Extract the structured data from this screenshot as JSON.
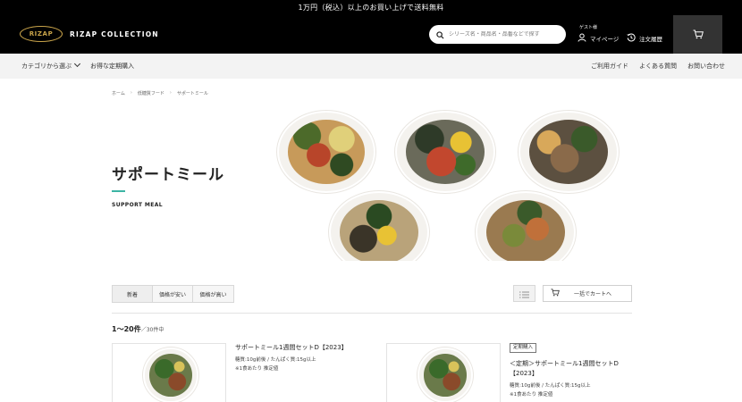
{
  "promo_banner": "1万円（税込）以上のお買い上げで送料無料",
  "header": {
    "logo_mark": "RIZAP",
    "logo_text": "RIZAP COLLECTION",
    "search_placeholder": "シリーズ名・商品名・品番などで探す",
    "guest_label": "ゲスト様",
    "mypage_label": "マイページ",
    "history_label": "注文履歴",
    "icons": {
      "search": "search-icon",
      "user": "user-icon",
      "history": "history-icon",
      "cart": "cart-icon"
    }
  },
  "nav": {
    "category_label": "カテゴリから選ぶ",
    "subscription_label": "お得な定期購入",
    "guide_label": "ご利用ガイド",
    "faq_label": "よくある質問",
    "contact_label": "お問い合わせ"
  },
  "breadcrumb": [
    "ホーム",
    "低糖質フード",
    "サポートミール"
  ],
  "page": {
    "title": "サポートミール",
    "subtitle": "SUPPORT MEAL",
    "accent_color": "#3cb4a4"
  },
  "toolbar": {
    "sort_options": [
      "新着",
      "価格が安い",
      "価格が高い"
    ],
    "bulk_cart_label": "一括でカートへ"
  },
  "results": {
    "range": "1〜20件",
    "total": "／30件中"
  },
  "products": [
    {
      "badge": "",
      "name": "サポートミール1週間セットD【2023】",
      "spec": "糖質:10g前後 / たんぱく質:15g以上",
      "note": "※1食あたり 推定値"
    },
    {
      "badge": "定期購入",
      "name": "＜定期＞サポートミール1週間セットD【2023】",
      "spec": "糖質:10g前後 / たんぱく質:15g以上",
      "note": "※1食あたり 推定値"
    }
  ]
}
